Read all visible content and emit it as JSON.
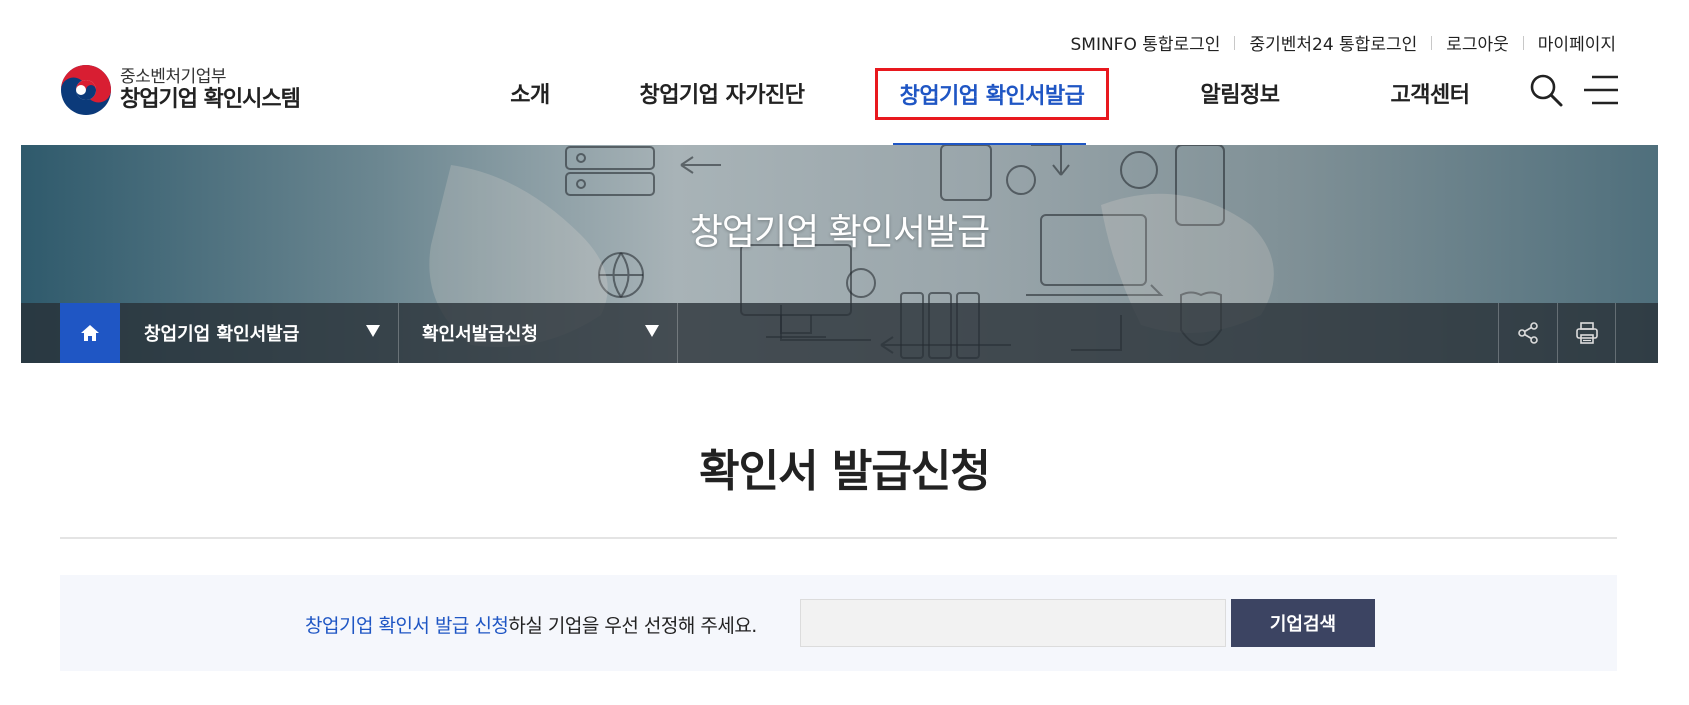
{
  "util_links": [
    "SMINFO 통합로그인",
    "중기벤처24 통합로그인",
    "로그아웃",
    "마이페이지"
  ],
  "logo": {
    "sub": "중소벤처기업부",
    "main": "창업기업 확인시스템"
  },
  "nav": [
    "소개",
    "창업기업 자가진단",
    "창업기업 확인서발급",
    "알림정보",
    "고객센터"
  ],
  "nav_active_index": 2,
  "banner": {
    "title": "창업기업 확인서발급"
  },
  "location": {
    "depth1": "창업기업 확인서발급",
    "depth2": "확인서발급신청"
  },
  "page_title": "확인서 발급신청",
  "search": {
    "guide_highlight": "창업기업 확인서 발급 신청",
    "guide_rest": "하실 기업을 우선 선정해 주세요.",
    "input_value": "",
    "button": "기업검색"
  },
  "icons": [
    "search-icon",
    "menu-icon",
    "home-icon",
    "share-icon",
    "print-icon",
    "caret-down-icon"
  ],
  "colors": {
    "accent": "#1f56c4",
    "highlight_border": "#e8181e",
    "button": "#3c4462"
  }
}
